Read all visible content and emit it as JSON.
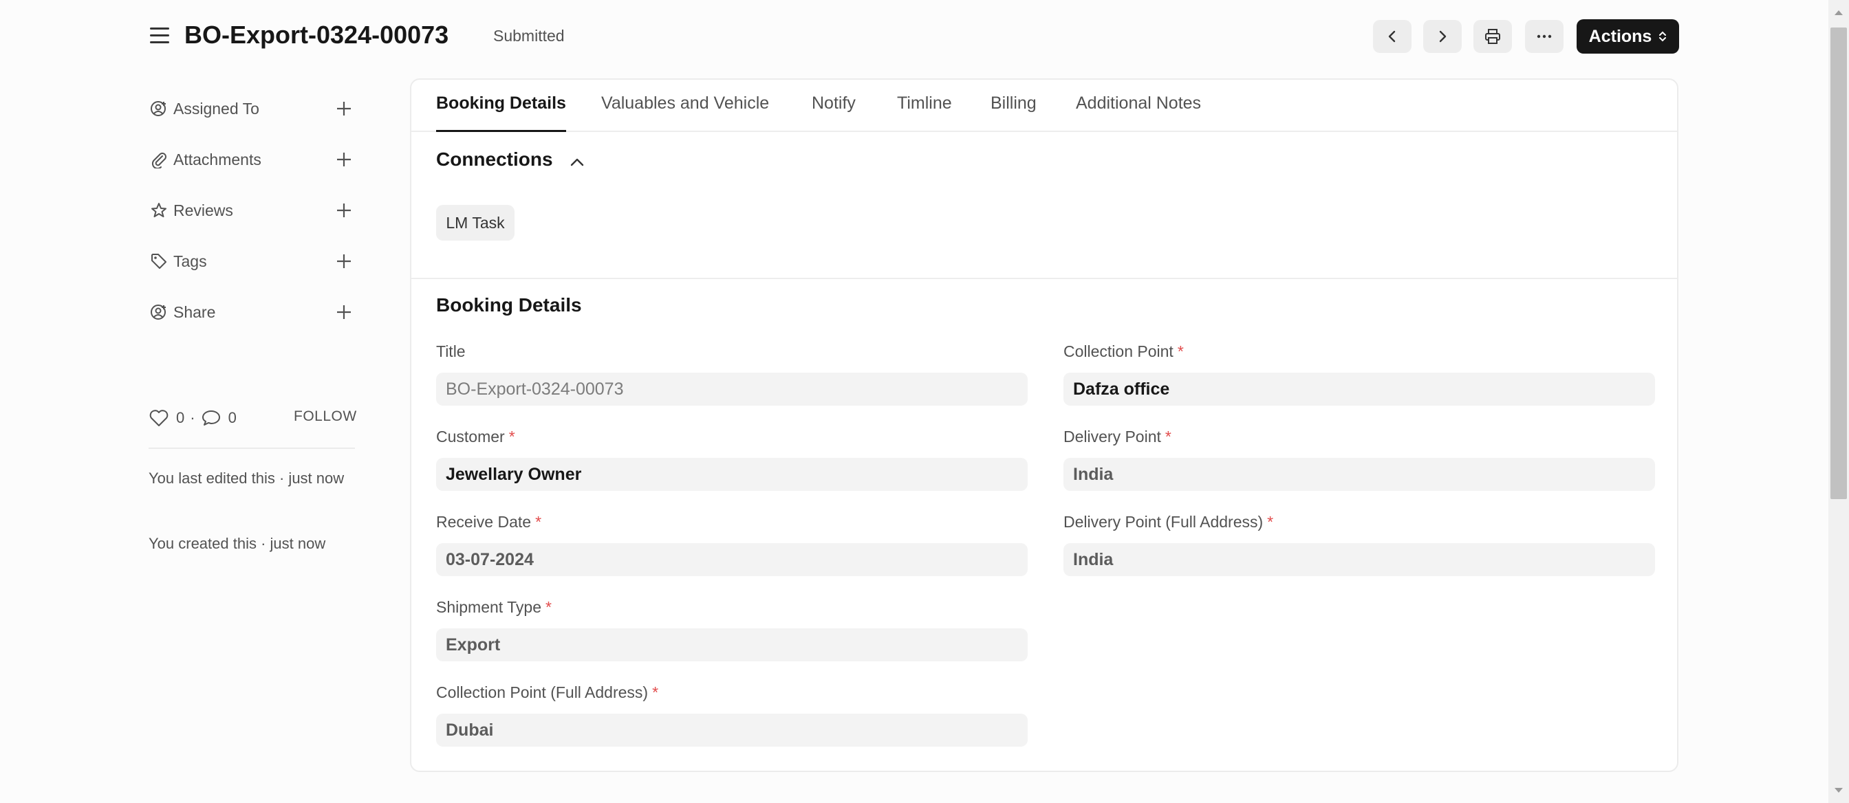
{
  "header": {
    "title": "BO-Export-0324-00073",
    "status": "Submitted",
    "actions_label": "Actions",
    "icons": [
      "hamburger-icon",
      "chevron-left-icon",
      "chevron-right-icon",
      "printer-icon",
      "more-icon",
      "sort-icon"
    ]
  },
  "sidebar": {
    "items": [
      {
        "label": "Assigned To",
        "icon": "assign-user-icon"
      },
      {
        "label": "Attachments",
        "icon": "paperclip-icon"
      },
      {
        "label": "Reviews",
        "icon": "star-icon"
      },
      {
        "label": "Tags",
        "icon": "tag-icon"
      },
      {
        "label": "Share",
        "icon": "share-user-icon"
      }
    ],
    "likes": "0",
    "comments": "0",
    "follow_label": "FOLLOW",
    "activity": [
      "You last edited this · just now",
      "You created this · just now"
    ]
  },
  "tabs": [
    {
      "label": "Booking Details",
      "active": true
    },
    {
      "label": "Valuables and Vehicle",
      "active": false
    },
    {
      "label": "Notify",
      "active": false
    },
    {
      "label": "Timline",
      "active": false
    },
    {
      "label": "Billing",
      "active": false
    },
    {
      "label": "Additional Notes",
      "active": false
    }
  ],
  "connections": {
    "title": "Connections",
    "chips": [
      "LM Task"
    ]
  },
  "booking": {
    "section_title": "Booking Details",
    "left_fields": [
      {
        "label": "Title",
        "value": "BO-Export-0324-00073",
        "required": false
      },
      {
        "label": "Customer",
        "value": "Jewellary Owner",
        "required": true
      },
      {
        "label": "Receive Date",
        "value": "03-07-2024",
        "required": true
      },
      {
        "label": "Shipment Type",
        "value": "Export",
        "required": true
      },
      {
        "label": "Collection Point (Full Address)",
        "value": "Dubai",
        "required": true
      }
    ],
    "right_fields": [
      {
        "label": "Collection Point",
        "value": "Dafza office",
        "required": true
      },
      {
        "label": "Delivery Point",
        "value": "India",
        "required": true
      },
      {
        "label": "Delivery Point (Full Address)",
        "value": "India",
        "required": true
      }
    ],
    "required_marker": "*"
  },
  "colors": {
    "accent": "#171717",
    "required": "#e24c4c",
    "input_bg": "#f3f3f3"
  }
}
